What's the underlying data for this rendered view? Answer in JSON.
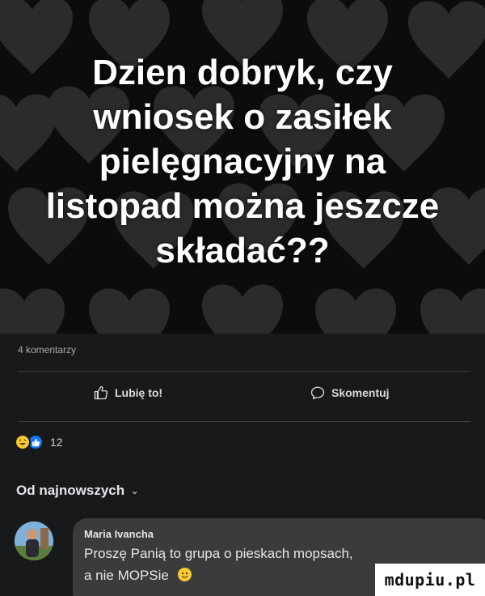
{
  "post": {
    "text_lines": [
      "Dzien dobryk, czy",
      "wniosek o zasiłek",
      "pielęgnacyjny na",
      "listopad można jeszcze",
      "składać??"
    ],
    "background_color": "#0c0c0c",
    "heart_color": "#2b2b2b"
  },
  "stats": {
    "comments_label": "4 komentarzy"
  },
  "actions": {
    "like_label": "Lubię to!",
    "comment_label": "Skomentuj"
  },
  "reactions": {
    "count": "12",
    "icons": [
      "haha-reaction-icon",
      "like-reaction-icon"
    ]
  },
  "sort": {
    "label": "Od najnowszych",
    "chevron": "⌄"
  },
  "comment": {
    "author": "Maria Ivancha",
    "text": "Proszę Panią to grupa o pieskach mopsach,",
    "text2": "a nie MOPSie",
    "bubble_color": "#3a3b3c"
  },
  "watermark": {
    "text": "mdupiu.pl"
  }
}
